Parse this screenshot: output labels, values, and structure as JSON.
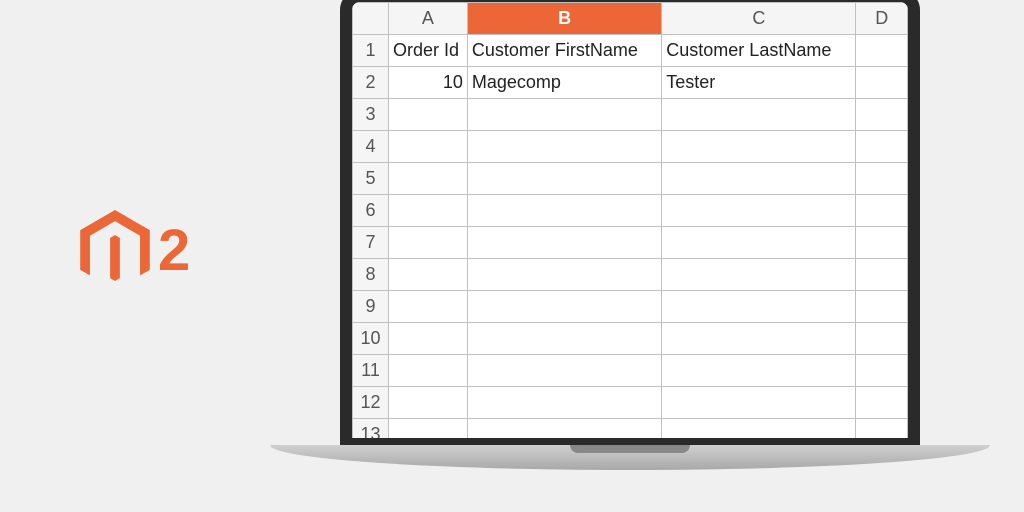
{
  "logo": {
    "text": "2"
  },
  "spreadsheet": {
    "columns": [
      {
        "letter": "A",
        "selected": false
      },
      {
        "letter": "B",
        "selected": true
      },
      {
        "letter": "C",
        "selected": false
      },
      {
        "letter": "D",
        "selected": false
      }
    ],
    "rowNumbers": [
      "1",
      "2",
      "3",
      "4",
      "5",
      "6",
      "7",
      "8",
      "9",
      "10",
      "11",
      "12",
      "13"
    ],
    "headerRow": {
      "A": "Order Id",
      "B": "Customer FirstName",
      "C": "Customer LastName",
      "D": ""
    },
    "dataRows": [
      {
        "A": "10",
        "B": "Magecomp",
        "C": "Tester",
        "D": ""
      }
    ]
  },
  "colors": {
    "accent": "#ec6737"
  }
}
